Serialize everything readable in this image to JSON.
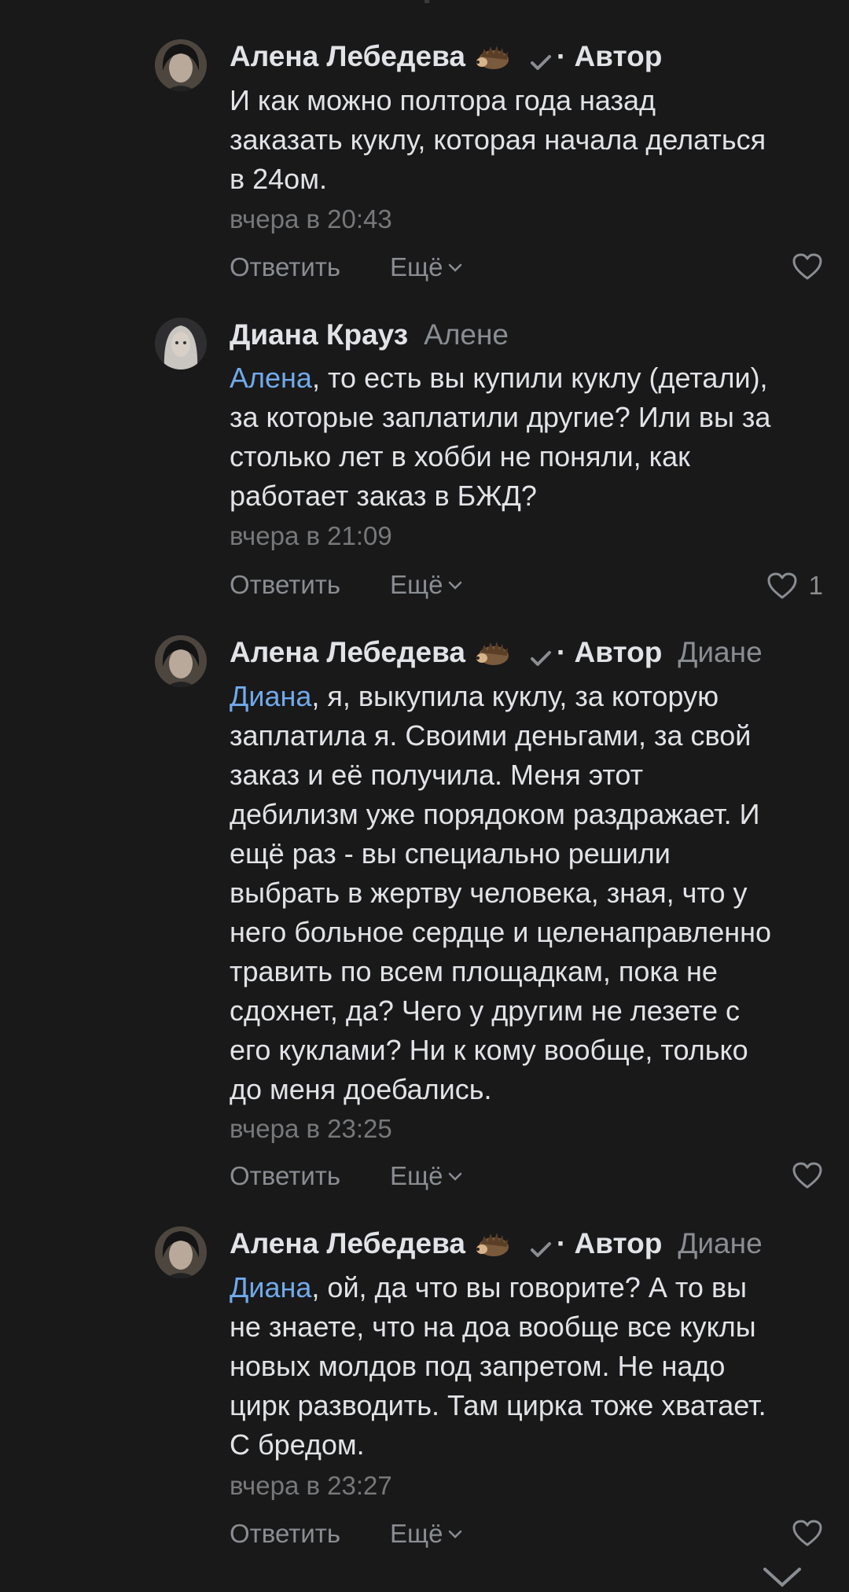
{
  "comments": [
    {
      "author": "Алена Лебедева",
      "author_tag": "· Автор",
      "reply_to": "",
      "mention": "",
      "text": "И как можно полтора года назад\nзаказать куклу, которая начала делаться\nв 24ом.",
      "time": "вчера в 20:43",
      "reply_label": "Ответить",
      "more_label": "Ещё",
      "likes": ""
    },
    {
      "author": "Диана Крауз",
      "author_tag": "",
      "reply_to": "Алене",
      "mention": "Алена",
      "text": ", то есть вы купили куклу (детали),\nза которые заплатили другие? Или вы за\nстолько лет в хобби не поняли, как\nработает заказ в БЖД?",
      "time": "вчера в 21:09",
      "reply_label": "Ответить",
      "more_label": "Ещё",
      "likes": "1"
    },
    {
      "author": "Алена Лебедева",
      "author_tag": "· Автор",
      "reply_to": "Диане",
      "mention": "Диана",
      "text": ", я, выкупила куклу, за которую\nзаплатила я. Своими деньгами, за свой\nзаказ и её получила. Меня этот\nдебилизм уже порядоком раздражает. И\nещё раз - вы специально решили\nвыбрать в жертву человека, зная, что у\nнего больное сердце и целенаправленно\nтравить по всем площадкам, пока не\nсдохнет, да? Чего у другим не лезете с\nего куклами? Ни к кому вообще, только\nдо меня доебались.",
      "time": "вчера в 23:25",
      "reply_label": "Ответить",
      "more_label": "Ещё",
      "likes": ""
    },
    {
      "author": "Алена Лебедева",
      "author_tag": "· Автор",
      "reply_to": "Диане",
      "mention": "Диана",
      "text": ", ой, да что вы говорите? А то вы\nне знаете, что на доа вообще все куклы\nновых молдов под запретом. Не надо\nцирк разводить. Там цирка тоже хватает.\nС бредом.",
      "time": "вчера в 23:27",
      "reply_label": "Ответить",
      "more_label": "Ещё",
      "likes": ""
    }
  ],
  "icons": {
    "like": "heart-outline-icon",
    "verified": "checkmark-icon",
    "emoji": "hedgehog-emoji-icon",
    "more": "chevron-down-icon",
    "scroll": "chevron-down-icon"
  },
  "colors": {
    "background": "#19191a",
    "text": "#e1e3e6",
    "secondary": "#8a8d91",
    "mention": "#71aaeb"
  }
}
